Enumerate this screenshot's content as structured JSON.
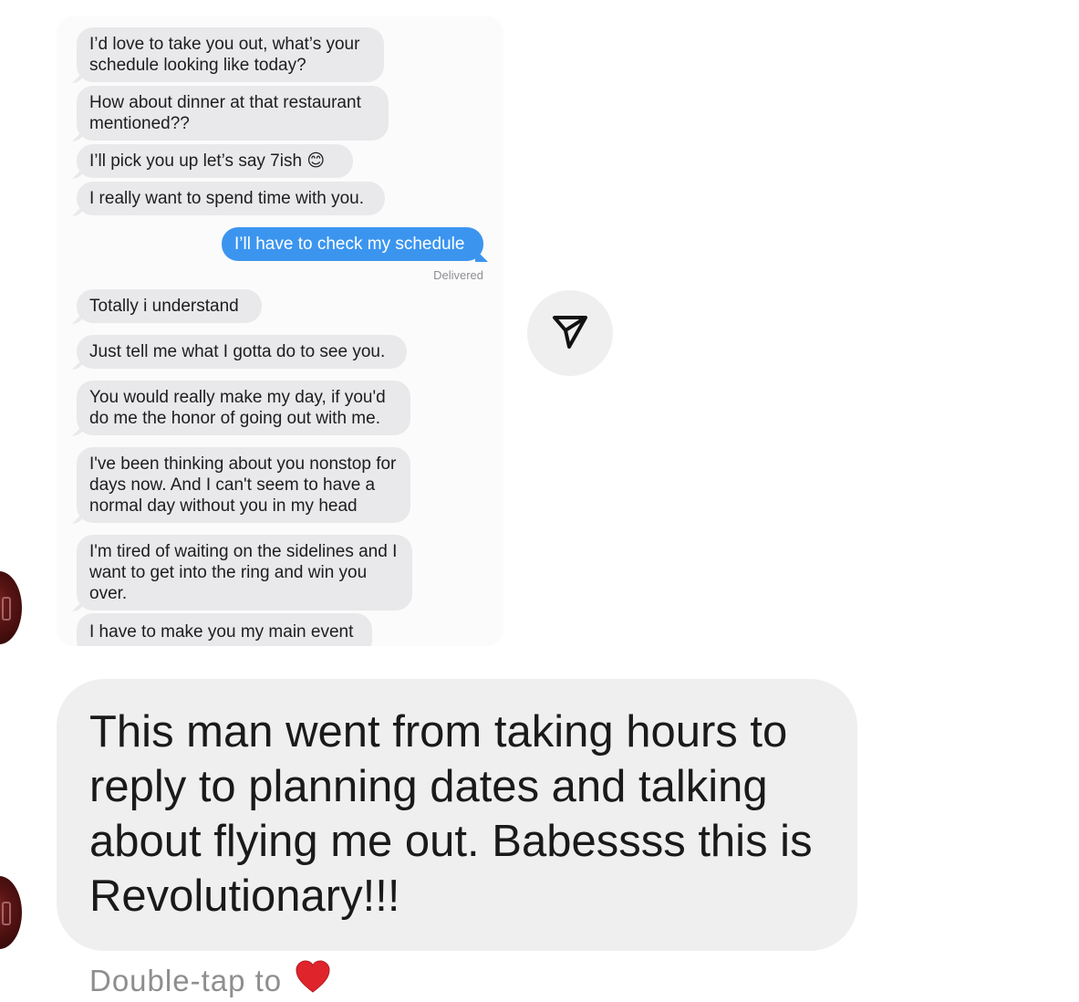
{
  "screenshot": {
    "messages": [
      "I’d love to take you out, what’s your schedule looking like today?",
      "How about dinner at that restaurant mentioned??",
      "I’ll pick you up let’s say 7ish 😊",
      "I really want to spend time with you.",
      "Totally i understand",
      "Just tell me what I gotta do to see you.",
      "You would really make my day, if you'd do me the honor of going out with me.",
      "I've been thinking about you nonstop for days now. And I can't seem to have a normal day without you in my head",
      "I'm tired of waiting on the sidelines and I want to get into the ring and win you over.",
      "I have to make you my main event"
    ],
    "sent_message": "I’ll have to check my schedule",
    "delivered_label": "Delivered"
  },
  "caption": {
    "text": "This man went from taking hours to reply to planning dates and talking about flying me out. Babessss this is Revolutionary!!!"
  },
  "footer": {
    "double_tap_label": "Double-tap to"
  },
  "icons": {
    "share": "paper-plane-icon",
    "like": "heart-icon"
  },
  "colors": {
    "sent_bubble": "#3b95ef",
    "received_bubble": "#e9e9eb",
    "caption_bubble": "#efefef",
    "heart": "#e0242b"
  }
}
